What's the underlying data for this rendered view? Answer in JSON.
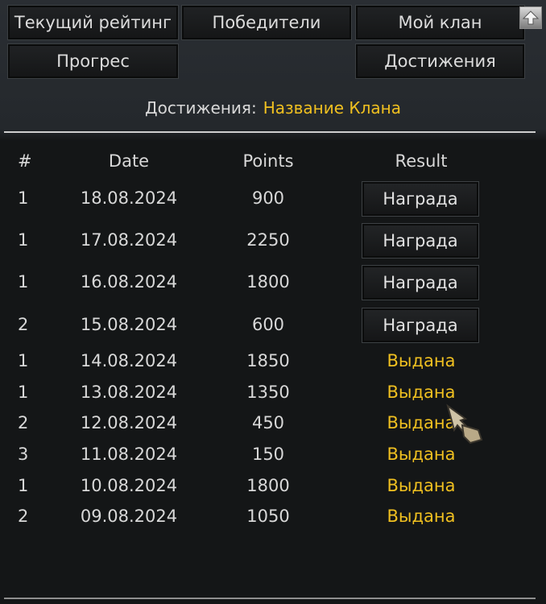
{
  "tabs": {
    "rating": "Текущий рейтинг",
    "winners": "Победители",
    "my_clan": "Мой клан",
    "progress": "Прогрес",
    "achievements": "Достижения"
  },
  "subtitle": {
    "label": "Достижения:",
    "clan_name": "Название Клана"
  },
  "table": {
    "headers": {
      "num": "#",
      "date": "Date",
      "points": "Points",
      "result": "Result"
    },
    "rows": [
      {
        "num": "1",
        "date": "18.08.2024",
        "points": "900",
        "result": "Награда",
        "type": "button"
      },
      {
        "num": "1",
        "date": "17.08.2024",
        "points": "2250",
        "result": "Награда",
        "type": "button"
      },
      {
        "num": "1",
        "date": "16.08.2024",
        "points": "1800",
        "result": "Награда",
        "type": "button"
      },
      {
        "num": "2",
        "date": "15.08.2024",
        "points": "600",
        "result": "Награда",
        "type": "button"
      },
      {
        "num": "1",
        "date": "14.08.2024",
        "points": "1850",
        "result": "Выдана",
        "type": "text"
      },
      {
        "num": "1",
        "date": "13.08.2024",
        "points": "1350",
        "result": "Выдана",
        "type": "text"
      },
      {
        "num": "2",
        "date": "12.08.2024",
        "points": "450",
        "result": "Выдана",
        "type": "text"
      },
      {
        "num": "3",
        "date": "11.08.2024",
        "points": "150",
        "result": "Выдана",
        "type": "text"
      },
      {
        "num": "1",
        "date": "10.08.2024",
        "points": "1800",
        "result": "Выдана",
        "type": "text"
      },
      {
        "num": "2",
        "date": "09.08.2024",
        "points": "1050",
        "result": "Выдана",
        "type": "text"
      }
    ]
  },
  "icons": {
    "scroll_up": "arrow-up-icon",
    "cursor": "pointer-hand-icon"
  },
  "colors": {
    "accent": "#f0c020",
    "text": "#d8d8d8",
    "background": "#141617"
  }
}
